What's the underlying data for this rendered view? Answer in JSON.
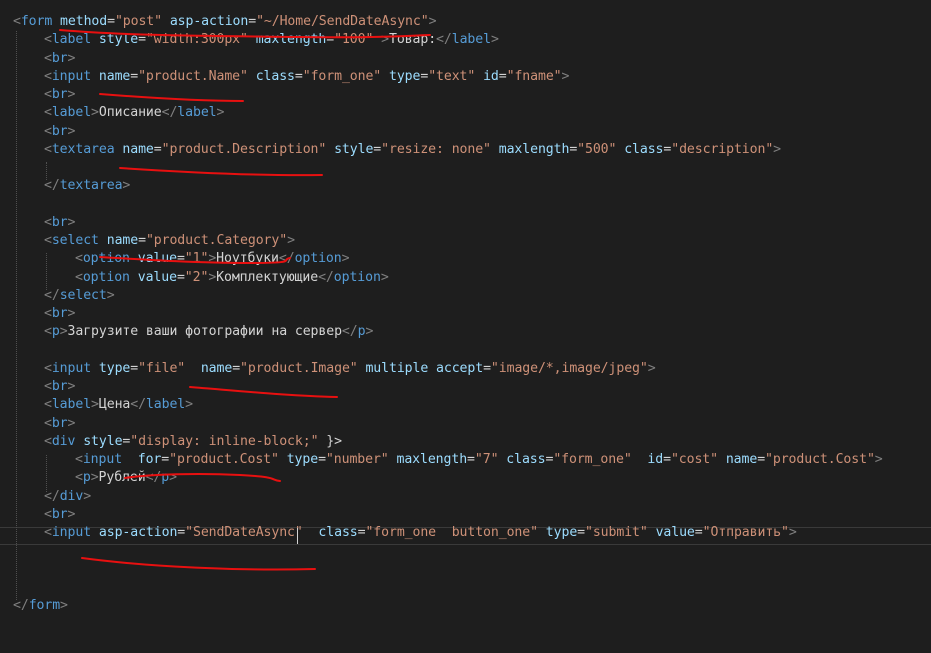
{
  "lines": [
    {
      "indent": 0,
      "tokens": [
        [
          "b",
          "<"
        ],
        [
          "t",
          "form"
        ],
        [
          "x",
          " "
        ],
        [
          "a",
          "method"
        ],
        [
          "x",
          "="
        ],
        [
          "s",
          "\"post\""
        ],
        [
          "x",
          " "
        ],
        [
          "a",
          "asp-action"
        ],
        [
          "x",
          "="
        ],
        [
          "s",
          "\"~/Home/SendDateAsync\""
        ],
        [
          "b",
          ">"
        ]
      ]
    },
    {
      "indent": 1,
      "tokens": [
        [
          "b",
          "<"
        ],
        [
          "t",
          "label"
        ],
        [
          "x",
          " "
        ],
        [
          "a",
          "style"
        ],
        [
          "x",
          "="
        ],
        [
          "s",
          "\"width:300px\""
        ],
        [
          "x",
          " "
        ],
        [
          "a",
          "maxlength"
        ],
        [
          "x",
          "="
        ],
        [
          "s",
          "\"100\""
        ],
        [
          "x",
          " "
        ],
        [
          "b",
          ">"
        ],
        [
          "x",
          "Товар:"
        ],
        [
          "b",
          "</"
        ],
        [
          "t",
          "label"
        ],
        [
          "b",
          ">"
        ]
      ]
    },
    {
      "indent": 1,
      "tokens": [
        [
          "b",
          "<"
        ],
        [
          "t",
          "br"
        ],
        [
          "b",
          ">"
        ]
      ]
    },
    {
      "indent": 1,
      "tokens": [
        [
          "b",
          "<"
        ],
        [
          "t",
          "input"
        ],
        [
          "x",
          " "
        ],
        [
          "a",
          "name"
        ],
        [
          "x",
          "="
        ],
        [
          "s",
          "\"product.Name\""
        ],
        [
          "x",
          " "
        ],
        [
          "a",
          "class"
        ],
        [
          "x",
          "="
        ],
        [
          "s",
          "\"form_one\""
        ],
        [
          "x",
          " "
        ],
        [
          "a",
          "type"
        ],
        [
          "x",
          "="
        ],
        [
          "s",
          "\"text\""
        ],
        [
          "x",
          " "
        ],
        [
          "a",
          "id"
        ],
        [
          "x",
          "="
        ],
        [
          "s",
          "\"fname\""
        ],
        [
          "b",
          ">"
        ]
      ]
    },
    {
      "indent": 1,
      "tokens": [
        [
          "b",
          "<"
        ],
        [
          "t",
          "br"
        ],
        [
          "b",
          ">"
        ]
      ]
    },
    {
      "indent": 1,
      "tokens": [
        [
          "b",
          "<"
        ],
        [
          "t",
          "label"
        ],
        [
          "b",
          ">"
        ],
        [
          "x",
          "Описание"
        ],
        [
          "b",
          "</"
        ],
        [
          "t",
          "label"
        ],
        [
          "b",
          ">"
        ]
      ]
    },
    {
      "indent": 1,
      "tokens": [
        [
          "b",
          "<"
        ],
        [
          "t",
          "br"
        ],
        [
          "b",
          ">"
        ]
      ]
    },
    {
      "indent": 1,
      "tokens": [
        [
          "b",
          "<"
        ],
        [
          "t",
          "textarea"
        ],
        [
          "x",
          " "
        ],
        [
          "a",
          "name"
        ],
        [
          "x",
          "="
        ],
        [
          "s",
          "\"product.Description\""
        ],
        [
          "x",
          " "
        ],
        [
          "a",
          "style"
        ],
        [
          "x",
          "="
        ],
        [
          "s",
          "\"resize: none\""
        ],
        [
          "x",
          " "
        ],
        [
          "a",
          "maxlength"
        ],
        [
          "x",
          "="
        ],
        [
          "s",
          "\"500\""
        ],
        [
          "x",
          " "
        ],
        [
          "a",
          "class"
        ],
        [
          "x",
          "="
        ],
        [
          "s",
          "\"description\""
        ],
        [
          "b",
          ">"
        ]
      ]
    },
    {
      "indent": 1,
      "tokens": []
    },
    {
      "indent": 1,
      "tokens": [
        [
          "b",
          "</"
        ],
        [
          "t",
          "textarea"
        ],
        [
          "b",
          ">"
        ]
      ]
    },
    {
      "indent": 1,
      "tokens": []
    },
    {
      "indent": 1,
      "tokens": [
        [
          "b",
          "<"
        ],
        [
          "t",
          "br"
        ],
        [
          "b",
          ">"
        ]
      ]
    },
    {
      "indent": 1,
      "tokens": [
        [
          "b",
          "<"
        ],
        [
          "t",
          "select"
        ],
        [
          "x",
          " "
        ],
        [
          "a",
          "name"
        ],
        [
          "x",
          "="
        ],
        [
          "s",
          "\"product.Category\""
        ],
        [
          "b",
          ">"
        ]
      ]
    },
    {
      "indent": 2,
      "tokens": [
        [
          "b",
          "<"
        ],
        [
          "t",
          "option"
        ],
        [
          "x",
          " "
        ],
        [
          "a",
          "value"
        ],
        [
          "x",
          "="
        ],
        [
          "s",
          "\"1\""
        ],
        [
          "b",
          ">"
        ],
        [
          "x",
          "Ноутбуки"
        ],
        [
          "b",
          "</"
        ],
        [
          "t",
          "option"
        ],
        [
          "b",
          ">"
        ]
      ]
    },
    {
      "indent": 2,
      "tokens": [
        [
          "b",
          "<"
        ],
        [
          "t",
          "option"
        ],
        [
          "x",
          " "
        ],
        [
          "a",
          "value"
        ],
        [
          "x",
          "="
        ],
        [
          "s",
          "\"2\""
        ],
        [
          "b",
          ">"
        ],
        [
          "x",
          "Комплектующие"
        ],
        [
          "b",
          "</"
        ],
        [
          "t",
          "option"
        ],
        [
          "b",
          ">"
        ]
      ]
    },
    {
      "indent": 1,
      "tokens": [
        [
          "b",
          "</"
        ],
        [
          "t",
          "select"
        ],
        [
          "b",
          ">"
        ]
      ]
    },
    {
      "indent": 1,
      "tokens": [
        [
          "b",
          "<"
        ],
        [
          "t",
          "br"
        ],
        [
          "b",
          ">"
        ]
      ]
    },
    {
      "indent": 1,
      "tokens": [
        [
          "b",
          "<"
        ],
        [
          "t",
          "p"
        ],
        [
          "b",
          ">"
        ],
        [
          "x",
          "Загрузите ваши фотографии на сервер"
        ],
        [
          "b",
          "</"
        ],
        [
          "t",
          "p"
        ],
        [
          "b",
          ">"
        ]
      ]
    },
    {
      "indent": 1,
      "tokens": []
    },
    {
      "indent": 1,
      "tokens": [
        [
          "b",
          "<"
        ],
        [
          "t",
          "input"
        ],
        [
          "x",
          " "
        ],
        [
          "a",
          "type"
        ],
        [
          "x",
          "="
        ],
        [
          "s",
          "\"file\""
        ],
        [
          "x",
          "  "
        ],
        [
          "a",
          "name"
        ],
        [
          "x",
          "="
        ],
        [
          "s",
          "\"product.Image\""
        ],
        [
          "x",
          " "
        ],
        [
          "a",
          "multiple"
        ],
        [
          "x",
          " "
        ],
        [
          "a",
          "accept"
        ],
        [
          "x",
          "="
        ],
        [
          "s",
          "\"image/*,image/jpeg\""
        ],
        [
          "b",
          ">"
        ]
      ]
    },
    {
      "indent": 1,
      "tokens": [
        [
          "b",
          "<"
        ],
        [
          "t",
          "br"
        ],
        [
          "b",
          ">"
        ]
      ]
    },
    {
      "indent": 1,
      "tokens": [
        [
          "b",
          "<"
        ],
        [
          "t",
          "label"
        ],
        [
          "b",
          ">"
        ],
        [
          "x",
          "Цена"
        ],
        [
          "b",
          "</"
        ],
        [
          "t",
          "label"
        ],
        [
          "b",
          ">"
        ]
      ]
    },
    {
      "indent": 1,
      "tokens": [
        [
          "b",
          "<"
        ],
        [
          "t",
          "br"
        ],
        [
          "b",
          ">"
        ]
      ]
    },
    {
      "indent": 1,
      "tokens": [
        [
          "b",
          "<"
        ],
        [
          "t",
          "div"
        ],
        [
          "x",
          " "
        ],
        [
          "a",
          "style"
        ],
        [
          "x",
          "="
        ],
        [
          "s",
          "\"display: inline-block;\""
        ],
        [
          "x",
          " }>"
        ]
      ]
    },
    {
      "indent": 2,
      "tokens": [
        [
          "b",
          "<"
        ],
        [
          "t",
          "input"
        ],
        [
          "x",
          "  "
        ],
        [
          "a",
          "for"
        ],
        [
          "x",
          "="
        ],
        [
          "s",
          "\"product.Cost\""
        ],
        [
          "x",
          " "
        ],
        [
          "a",
          "type"
        ],
        [
          "x",
          "="
        ],
        [
          "s",
          "\"number\""
        ],
        [
          "x",
          " "
        ],
        [
          "a",
          "maxlength"
        ],
        [
          "x",
          "="
        ],
        [
          "s",
          "\"7\""
        ],
        [
          "x",
          " "
        ],
        [
          "a",
          "class"
        ],
        [
          "x",
          "="
        ],
        [
          "s",
          "\"form_one\""
        ],
        [
          "x",
          "  "
        ],
        [
          "a",
          "id"
        ],
        [
          "x",
          "="
        ],
        [
          "s",
          "\"cost\""
        ],
        [
          "x",
          " "
        ],
        [
          "a",
          "name"
        ],
        [
          "x",
          "="
        ],
        [
          "s",
          "\"product.Cost\""
        ],
        [
          "b",
          ">"
        ]
      ]
    },
    {
      "indent": 2,
      "tokens": [
        [
          "b",
          "<"
        ],
        [
          "t",
          "p"
        ],
        [
          "b",
          ">"
        ],
        [
          "x",
          "Рублей"
        ],
        [
          "b",
          "</"
        ],
        [
          "t",
          "p"
        ],
        [
          "b",
          ">"
        ]
      ]
    },
    {
      "indent": 1,
      "tokens": [
        [
          "b",
          "</"
        ],
        [
          "t",
          "div"
        ],
        [
          "b",
          ">"
        ]
      ]
    },
    {
      "indent": 1,
      "tokens": [
        [
          "b",
          "<"
        ],
        [
          "t",
          "br"
        ],
        [
          "b",
          ">"
        ]
      ]
    },
    {
      "indent": 1,
      "tokens": [
        [
          "b",
          "<"
        ],
        [
          "t",
          "input"
        ],
        [
          "x",
          " "
        ],
        [
          "a",
          "asp-action"
        ],
        [
          "x",
          "="
        ],
        [
          "s",
          "\"SendDateAsync\""
        ],
        [
          "x",
          "  "
        ],
        [
          "a",
          "class"
        ],
        [
          "x",
          "="
        ],
        [
          "s",
          "\"form_one  button_one\""
        ],
        [
          "x",
          " "
        ],
        [
          "a",
          "type"
        ],
        [
          "x",
          "="
        ],
        [
          "s",
          "\"submit\""
        ],
        [
          "x",
          " "
        ],
        [
          "a",
          "value"
        ],
        [
          "x",
          "="
        ],
        [
          "s",
          "\"Отправить\""
        ],
        [
          "b",
          ">"
        ]
      ]
    },
    {
      "indent": 0,
      "tokens": []
    },
    {
      "indent": 0,
      "tokens": []
    },
    {
      "indent": 0,
      "tokens": []
    },
    {
      "indent": 0,
      "tokens": [
        [
          "b",
          "</"
        ],
        [
          "t",
          "form"
        ],
        [
          "b",
          ">"
        ]
      ]
    }
  ],
  "colors": {
    "background": "#1e1e1e",
    "tag": "#569cd6",
    "bracket": "#808080",
    "attribute": "#9cdcfe",
    "string": "#ce9178",
    "text": "#d4d4d4",
    "annotation": "#e81010"
  }
}
